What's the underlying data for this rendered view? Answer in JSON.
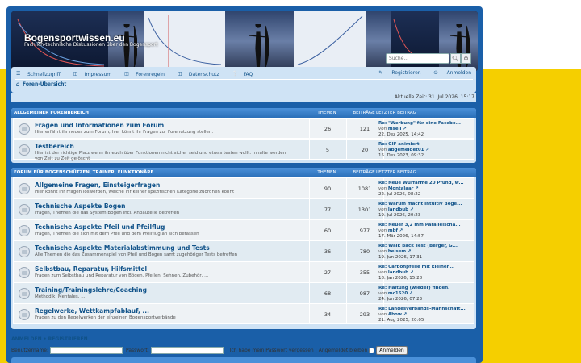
{
  "header": {
    "site_title": "Bogensportwissen.eu",
    "site_description": "Fachlich-technische Diskussionen über den Bogensport",
    "search_placeholder": "Suche..."
  },
  "nav": {
    "links": [
      "Schnellzugriff",
      "Impressum",
      "Forenregeln",
      "Datenschutz",
      "FAQ"
    ],
    "right_links": [
      "Registrieren",
      "Anmelden"
    ],
    "breadcrumb": "Foren-Übersicht"
  },
  "time": "Aktuelle Zeit: 31. Jul 2026, 15:17",
  "columns": {
    "topics": "THEMEN",
    "posts": "BEITRÄGE",
    "last": "LETZTER BEITRAG"
  },
  "categories": [
    {
      "title": "ALLGEMEINER FORENBEREICH",
      "forums": [
        {
          "title": "Fragen und Informationen zum Forum",
          "desc": "Hier erfährt ihr neues zum Forum, hier könnt ihr Fragen zur Forenutzung stellen.",
          "topics": "26",
          "posts": "121",
          "last_title": "Re: \"Werbung\" für eine Facebo...",
          "last_user": "msell",
          "last_time": "22. Dez 2025, 14:42"
        },
        {
          "title": "Testbereich",
          "desc": "Hier ist der richtige Platz wenn ihr euch über Funktionen nicht sicher seid und etwas testen wollt. Inhalte werden von Zeit zu Zeit gelöscht",
          "topics": "5",
          "posts": "20",
          "last_title": "Re: GIF animiert",
          "last_user": "abgemeldet01",
          "last_time": "15. Dez 2023, 09:32"
        }
      ]
    },
    {
      "title": "FORUM FÜR BOGENSCHÜTZEN, TRAINER, FUNKTIONÄRE",
      "forums": [
        {
          "title": "Allgemeine Fragen, Einsteigerfragen",
          "desc": "Hier könnt ihr Fragen loswerden, welche ihr keiner spezifischen Kategorie zuordnen könnt",
          "topics": "90",
          "posts": "1081",
          "last_title": "Re: Neue Wurfarme 20 Pfund, w...",
          "last_user": "Montalaar",
          "last_time": "22. Jul 2026, 08:22"
        },
        {
          "title": "Technische Aspekte Bogen",
          "desc": "Fragen, Themen die das System Bogen incl. Anbauteile betreffen",
          "topics": "77",
          "posts": "1301",
          "last_title": "Re: Warum macht Intuitiv Boge...",
          "last_user": "landbub",
          "last_time": "19. Jul 2026, 20:23"
        },
        {
          "title": "Technische Aspekte Pfeil und Pfeilflug",
          "desc": "Fragen, Themen die sich mit dem Pfeil und dem Pfeilflug an sich befassen",
          "topics": "60",
          "posts": "977",
          "last_title": "Re: Neuer 3,2 mm Parallelscha...",
          "last_user": "mbf",
          "last_time": "17. Mär 2026, 14:57"
        },
        {
          "title": "Technische Aspekte Materialabstimmung und Tests",
          "desc": "Alle Themen die das Zusammenspiel von Pfeil und Bogen samt zugehöriger Tests betreffen",
          "topics": "36",
          "posts": "780",
          "last_title": "Re: Walk Back Test (Berger, G...",
          "last_user": "heisem",
          "last_time": "19. Jun 2026, 17:31"
        },
        {
          "title": "Selbstbau, Reparatur, Hilfsmittel",
          "desc": "Fragen zum Selbstbau und Reparatur von Bögen, Pfeilen, Sehnen, Zubehör, ...",
          "topics": "27",
          "posts": "355",
          "last_title": "Re: Carbonpfeile mit kleiner...",
          "last_user": "landbub",
          "last_time": "18. Jan 2026, 15:28"
        },
        {
          "title": "Training/Trainingslehre/Coaching",
          "desc": "Methodik, Mentales, ...",
          "topics": "68",
          "posts": "987",
          "last_title": "Re: Haltung (wieder) finden.",
          "last_user": "mc1620",
          "last_time": "24. Jun 2026, 07:23"
        },
        {
          "title": "Regelwerke, Wettkampfablauf, ...",
          "desc": "Fragen zu den Regelwerken der einzelnen Bogensportverbände",
          "topics": "34",
          "posts": "293",
          "last_title": "Re: Landesverbands-Mannschaft...",
          "last_user": "Abow",
          "last_time": "21. Aug 2025, 20:05"
        }
      ]
    }
  ],
  "login": {
    "heading": "ANMELDEN  •  REGISTRIEREN",
    "username_label": "Benutzername:",
    "password_label": "Passwort:",
    "forgot": "Ich habe mein Passwort vergessen",
    "remember": "Angemeldet bleiben",
    "button": "Anmelden"
  },
  "by_label": "von"
}
